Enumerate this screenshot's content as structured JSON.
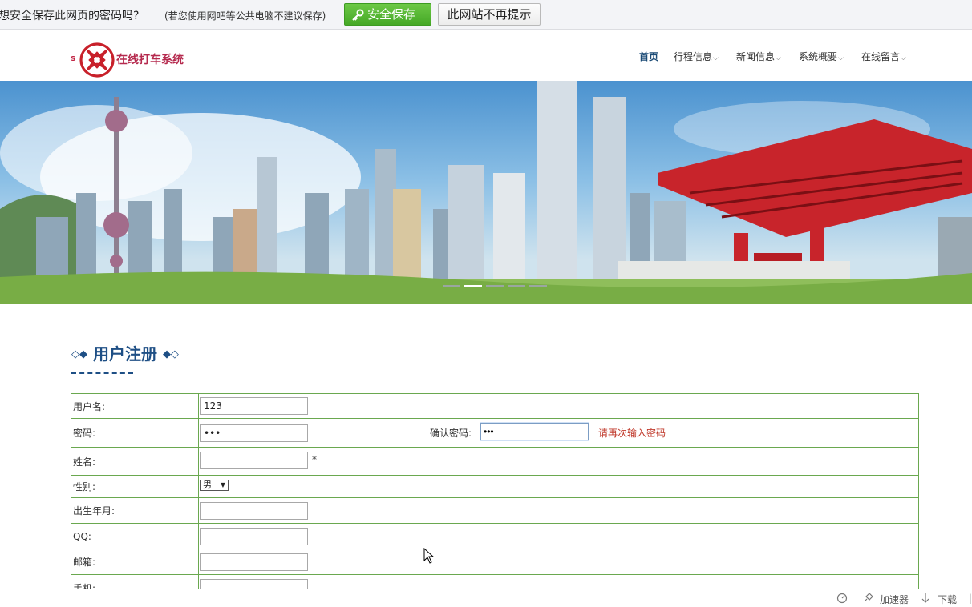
{
  "password_bar": {
    "question": "想安全保存此网页的密码吗?",
    "hint": "(若您使用网吧等公共电脑不建议保存)",
    "save_button": "安全保存",
    "never_button": "此网站不再提示"
  },
  "header": {
    "logo_s": "s",
    "site_name": "在线打车系统",
    "nav": [
      {
        "label": "首页"
      },
      {
        "label": "行程信息"
      },
      {
        "label": "新闻信息"
      },
      {
        "label": "系统概要"
      },
      {
        "label": "在线留言"
      }
    ]
  },
  "section": {
    "title": "用户注册",
    "left_deco": "◇◆",
    "right_deco": "◆◇"
  },
  "form": {
    "username_label": "用户名:",
    "username_value": "123",
    "password_label": "密码:",
    "password_value": "•••",
    "confirm_label": "确认密码:",
    "confirm_value": "•••",
    "confirm_error": "请再次输入密码",
    "name_label": "姓名:",
    "required_mark": "*",
    "gender_label": "性别:",
    "gender_value": "男",
    "birth_label": "出生年月:",
    "qq_label": "QQ:",
    "email_label": "邮箱:",
    "phone_label": "手机:"
  },
  "status_bar": {
    "accelerator": "加速器",
    "download": "下载"
  },
  "colors": {
    "accent": "#1e4f85",
    "border": "#6aa84f",
    "save_green": "#45a826",
    "error": "#c0392b"
  }
}
